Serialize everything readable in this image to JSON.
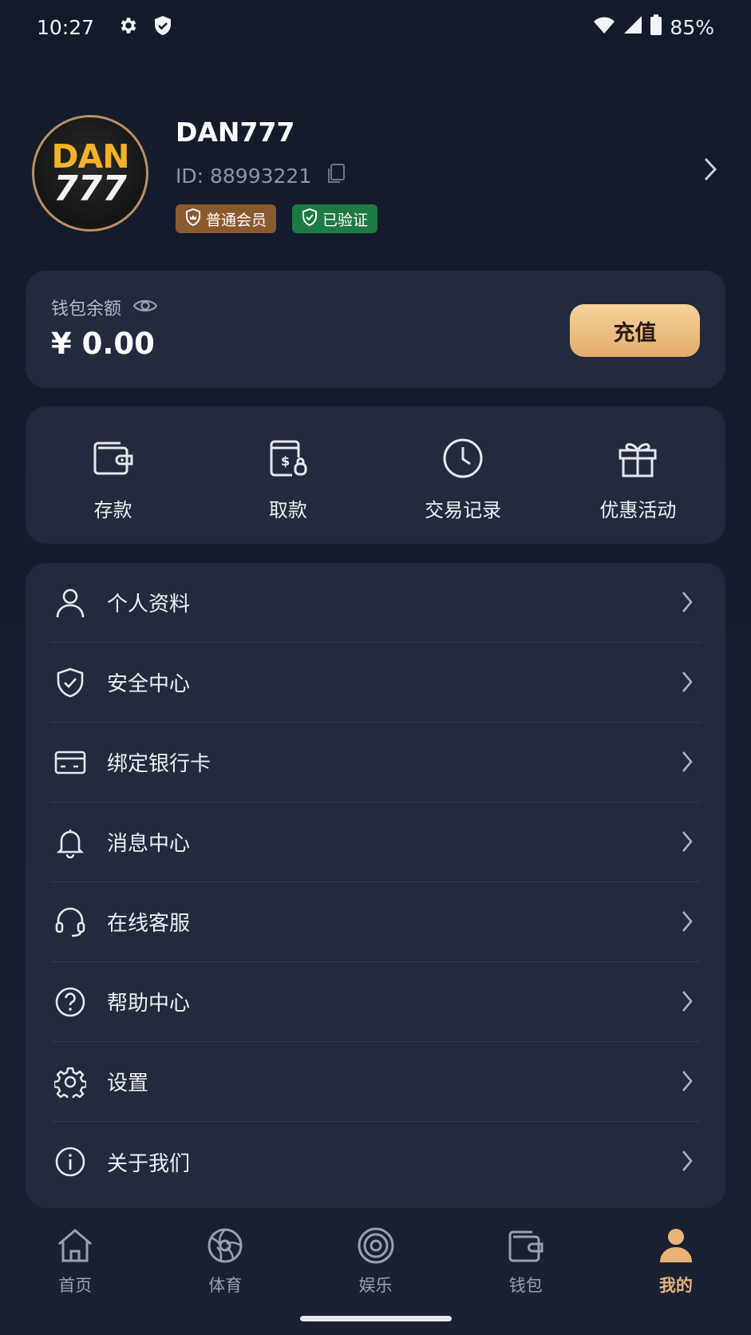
{
  "status_bar": {
    "time": "10:27",
    "battery": "85%"
  },
  "profile": {
    "avatar_line1": "DAN",
    "avatar_line2": "777",
    "username": "DAN777",
    "user_id": "ID: 88993221",
    "badges": {
      "member": "普通会员",
      "verified": "已验证"
    }
  },
  "wallet": {
    "label": "钱包余额",
    "amount": "¥ 0.00",
    "recharge_label": "充值"
  },
  "quick_actions": [
    {
      "label": "存款",
      "icon": "wallet-icon"
    },
    {
      "label": "取款",
      "icon": "withdraw-icon"
    },
    {
      "label": "交易记录",
      "icon": "clock-icon"
    },
    {
      "label": "优惠活动",
      "icon": "gift-icon"
    }
  ],
  "menu": [
    {
      "label": "个人资料",
      "icon": "user-icon"
    },
    {
      "label": "安全中心",
      "icon": "shield-check-icon"
    },
    {
      "label": "绑定银行卡",
      "icon": "bank-card-icon"
    },
    {
      "label": "消息中心",
      "icon": "bell-icon"
    },
    {
      "label": "在线客服",
      "icon": "headset-icon"
    },
    {
      "label": "帮助中心",
      "icon": "help-icon"
    },
    {
      "label": "设置",
      "icon": "gear-icon"
    },
    {
      "label": "关于我们",
      "icon": "info-icon"
    }
  ],
  "tabs": [
    {
      "label": "首页",
      "icon": "home-icon"
    },
    {
      "label": "体育",
      "icon": "sports-icon"
    },
    {
      "label": "娱乐",
      "icon": "entertainment-icon"
    },
    {
      "label": "钱包",
      "icon": "wallet-icon"
    },
    {
      "label": "我的",
      "icon": "profile-icon",
      "active": true
    }
  ],
  "colors": {
    "accent": "#e8b476",
    "card": "#232a3d",
    "background": "#131a2a"
  }
}
